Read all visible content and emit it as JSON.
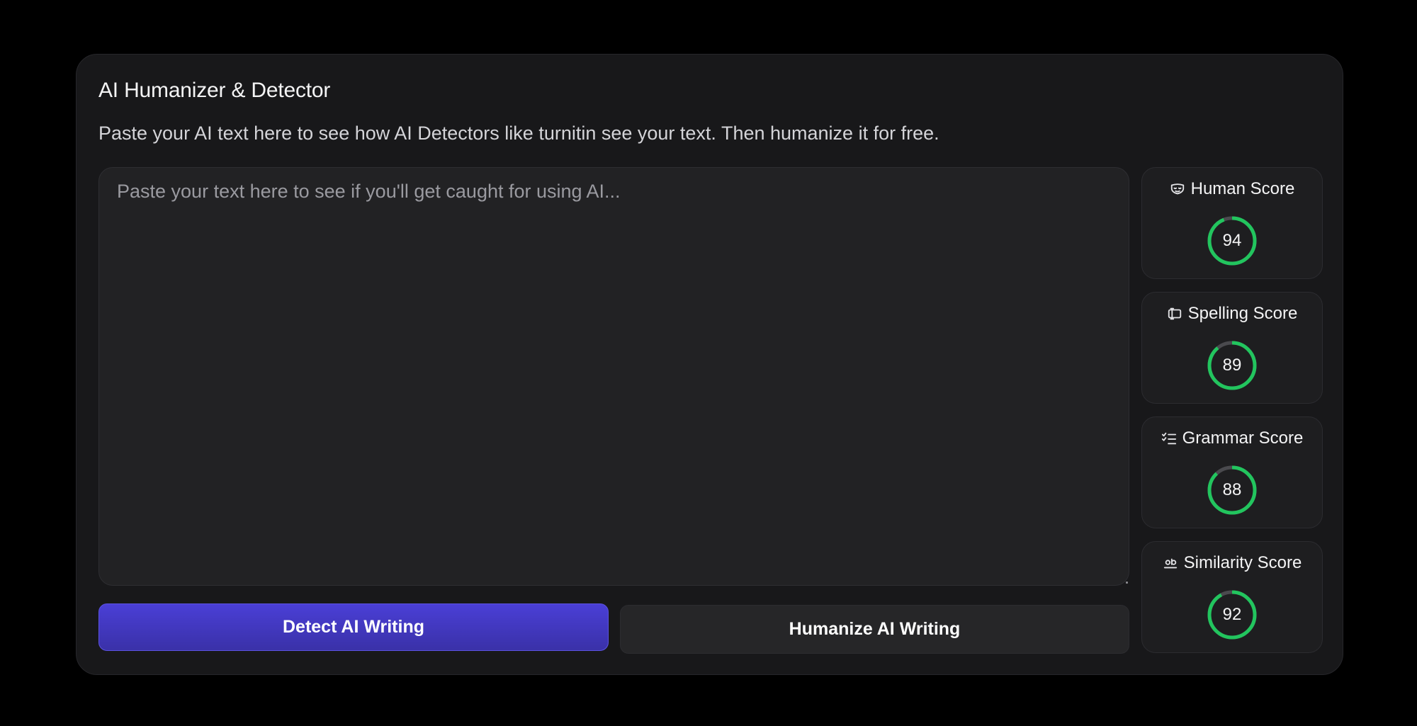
{
  "header": {
    "title": "AI Humanizer & Detector",
    "subtitle": "Paste your AI text here to see how AI Detectors like turnitin see your text. Then humanize it for free."
  },
  "editor": {
    "placeholder": "Paste your text here to see if you'll get caught for using AI...",
    "value": ""
  },
  "actions": {
    "detect_label": "Detect AI Writing",
    "humanize_label": "Humanize AI Writing"
  },
  "colors": {
    "accent": "#4a3fd6",
    "ring_fill": "#22c55e",
    "ring_track": "#4a4a4e"
  },
  "scores": [
    {
      "label": "Human Score",
      "value": 94,
      "icon": "mask-icon"
    },
    {
      "label": "Spelling Score",
      "value": 89,
      "icon": "spelling-icon"
    },
    {
      "label": "Grammar Score",
      "value": 88,
      "icon": "checklist-icon"
    },
    {
      "label": "Similarity Score",
      "value": 92,
      "icon": "similarity-icon"
    }
  ]
}
